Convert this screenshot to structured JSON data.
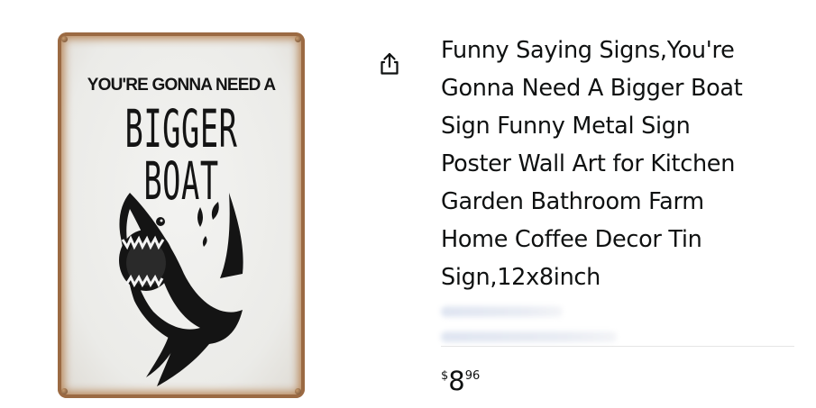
{
  "product": {
    "image_alt": "YOU'RE GONNA NEED A BIGGER BOAT metal sign",
    "sign_text_line1": "YOU'RE GONNA NEED A",
    "sign_text_line2": "BIGGER BOAT",
    "title_lines": [
      "Funny Saying Signs,You're",
      "Gonna Need A Bigger Boat",
      "Sign Funny Metal Sign",
      "Poster Wall Art for Kitchen",
      "Garden Bathroom Farm",
      "Home Coffee Decor Tin",
      "Sign,12x8inch"
    ],
    "price": {
      "currency_symbol": "$",
      "whole": "8",
      "fraction": "96"
    },
    "share_icon": "share-icon"
  },
  "colors": {
    "text": "#0f1111",
    "sign_rust": "#9b6a43"
  }
}
